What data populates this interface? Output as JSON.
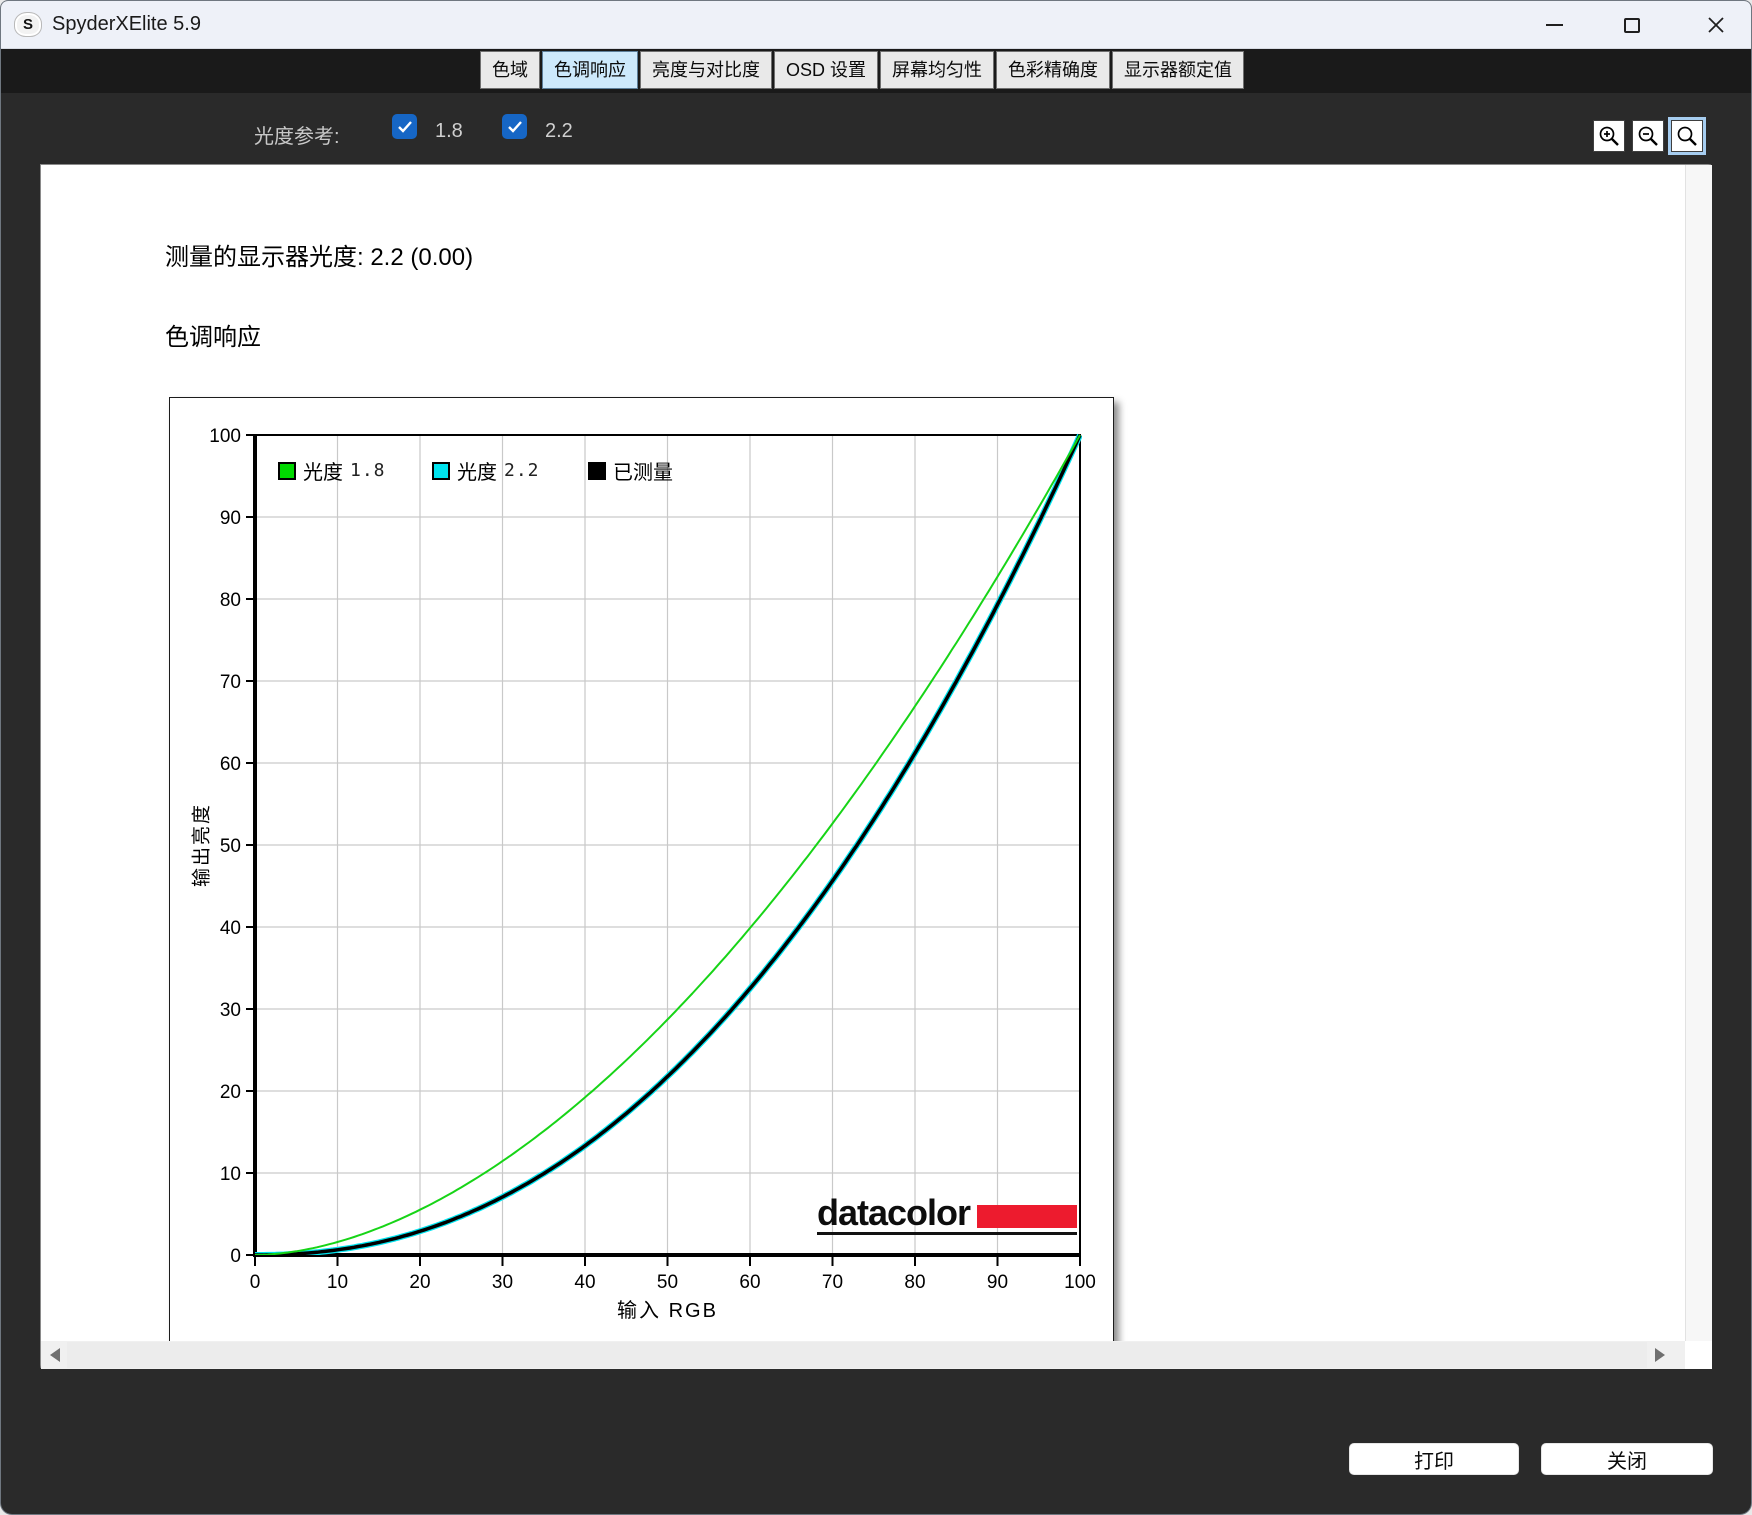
{
  "window": {
    "title": "SpyderXElite 5.9",
    "logo_letter": "S"
  },
  "tabs": {
    "selected_index": 1,
    "items": [
      {
        "label": "色域"
      },
      {
        "label": "色调响应"
      },
      {
        "label": "亮度与对比度"
      },
      {
        "label": "OSD 设置"
      },
      {
        "label": "屏幕均匀性"
      },
      {
        "label": "色彩精确度"
      },
      {
        "label": "显示器额定值"
      }
    ]
  },
  "toolbar": {
    "reference_label": "光度参考:",
    "gamma_options": [
      {
        "label": "1.8",
        "checked": true
      },
      {
        "label": "2.2",
        "checked": true
      }
    ],
    "zoom_buttons": [
      "zoom-in",
      "zoom-out",
      "zoom-select"
    ]
  },
  "content": {
    "measured_line": "测量的显示器光度:  2.2 (0.00)",
    "section_title": "色调响应"
  },
  "chart_data": {
    "type": "line",
    "title": "色调响应",
    "xlabel": "输入  RGB",
    "ylabel": "输出亮度",
    "xlim": [
      0,
      100
    ],
    "ylim": [
      0,
      100
    ],
    "xticks": [
      0,
      10,
      20,
      30,
      40,
      50,
      60,
      70,
      80,
      90,
      100
    ],
    "yticks": [
      0,
      10,
      20,
      30,
      40,
      50,
      60,
      70,
      80,
      90,
      100
    ],
    "grid": true,
    "legend_position": "top-left",
    "legend": [
      {
        "label": "光度",
        "value": "1.8",
        "color": "#00d900"
      },
      {
        "label": "光度",
        "value": "2.2",
        "color": "#00e4ef"
      },
      {
        "label": "已测量",
        "value": "",
        "color": "#000000"
      }
    ],
    "x": [
      0,
      10,
      20,
      30,
      40,
      50,
      60,
      70,
      80,
      90,
      100
    ],
    "series": [
      {
        "name": "光度 1.8",
        "gamma": 1.8,
        "color": "#17d417",
        "width": 2,
        "z": 3,
        "values": [
          0,
          1.6,
          5.5,
          11.5,
          19.2,
          28.7,
          39.9,
          52.6,
          66.9,
          82.7,
          100
        ]
      },
      {
        "name": "光度 2.2",
        "gamma": 2.2,
        "color": "#00e4ef",
        "width": 6,
        "z": 1,
        "values": [
          0,
          0.6,
          2.9,
          7.1,
          13.4,
          21.8,
          32.5,
          45.6,
          61.2,
          79.3,
          100
        ]
      },
      {
        "name": "已测量",
        "gamma": 2.2,
        "color": "#000000",
        "width": 3.5,
        "z": 2,
        "values": [
          0,
          0.6,
          2.9,
          7.1,
          13.4,
          21.8,
          32.5,
          45.6,
          61.2,
          79.3,
          100
        ]
      }
    ],
    "branding": {
      "text": "datacolor",
      "bar_color": "#ed1b2e"
    }
  },
  "footer": {
    "print_label": "打印",
    "close_label": "关闭"
  },
  "colors": {
    "accent_blue": "#1666c5",
    "selected_tab": "#cde9fc",
    "dark_bg": "#2a2a2a",
    "titlebar_bg": "#eef1f8",
    "curve_green": "#17d417",
    "curve_cyan": "#00e4ef",
    "curve_black": "#000000",
    "datacolor_red": "#ed1b2e"
  }
}
